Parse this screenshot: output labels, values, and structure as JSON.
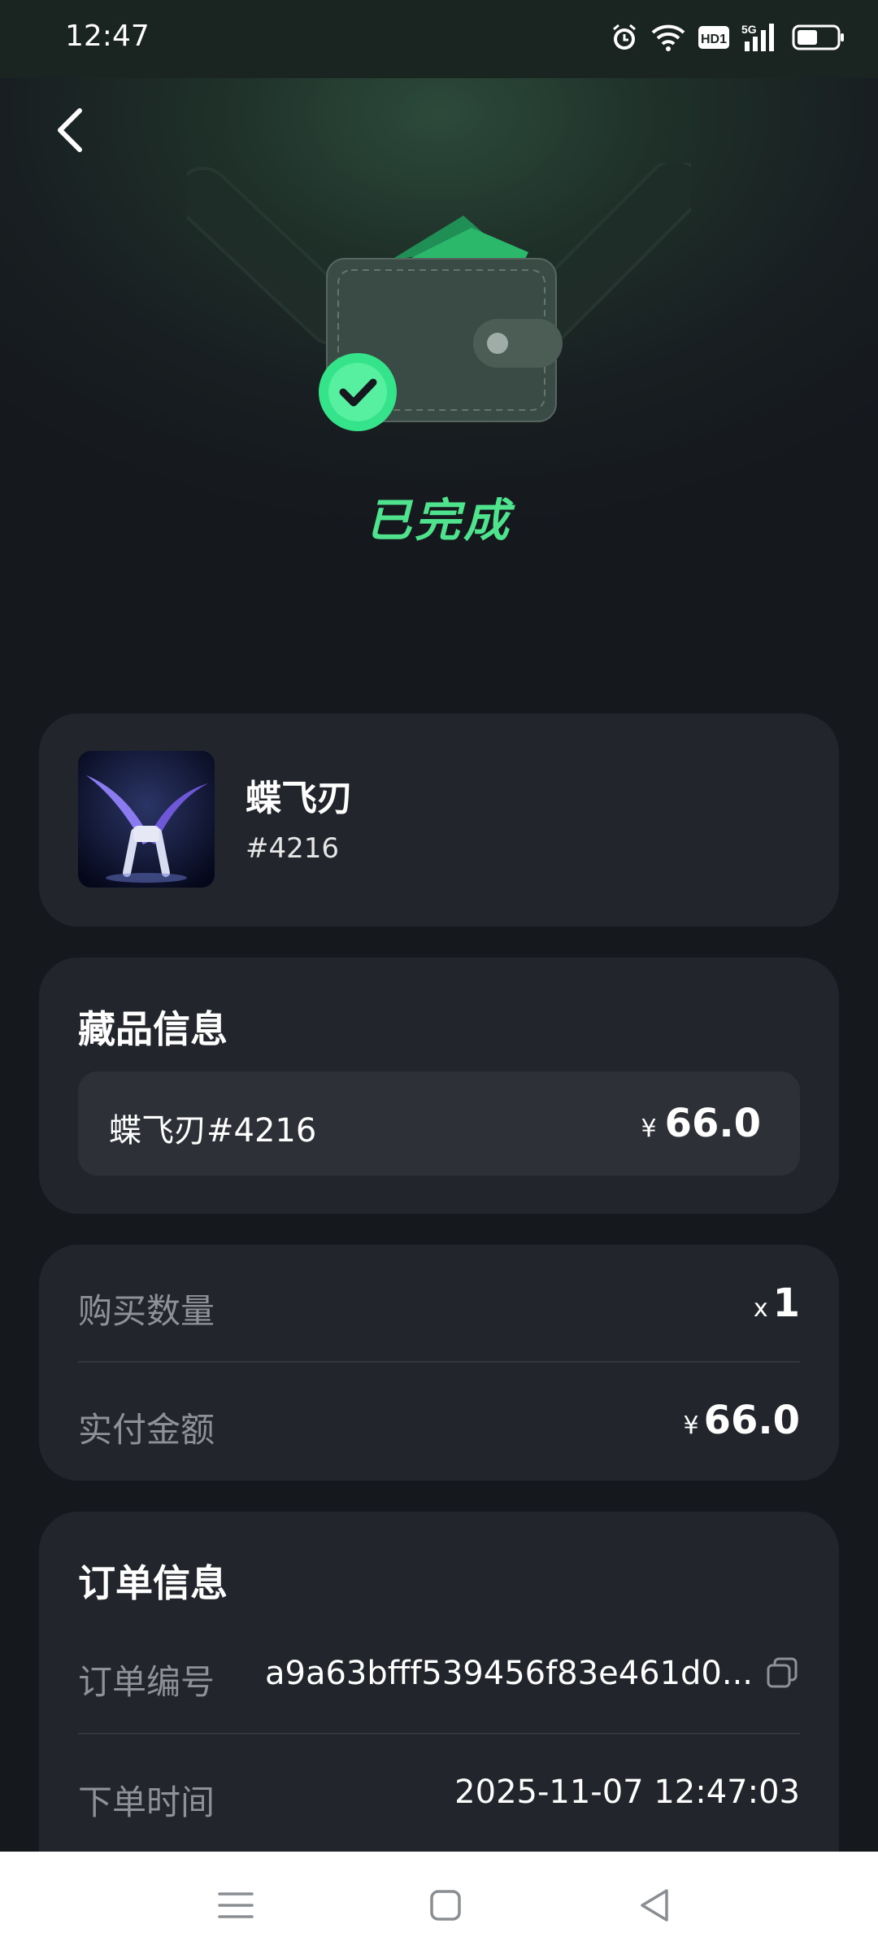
{
  "status_bar": {
    "time": "12:47",
    "icons": [
      "alarm-icon",
      "wifi-icon",
      "hd-icon",
      "signal-5g-icon",
      "battery-icon"
    ],
    "hd_label": "HD1",
    "network_label": "5G"
  },
  "header": {
    "back_icon": "chevron-left-icon"
  },
  "hero": {
    "status": "已完成",
    "accent": "#4fe38e"
  },
  "product": {
    "name": "蝶飞刃",
    "number": "#4216"
  },
  "collection": {
    "title": "藏品信息",
    "item_name": "蝶飞刃#4216",
    "currency": "¥",
    "price": "66.0"
  },
  "purchase": {
    "quantity_label": "购买数量",
    "quantity_prefix": "x",
    "quantity": "1",
    "paid_label": "实付金额",
    "currency": "¥",
    "paid_amount": "66.0"
  },
  "order": {
    "title": "订单信息",
    "number_label": "订单编号",
    "number_value": "a9a63bfff539456f83e461d0...",
    "time_label": "下单时间",
    "time_value": "2025-11-07 12:47:03"
  },
  "nav": {
    "icons": [
      "menu-icon",
      "home-icon",
      "back-icon"
    ]
  }
}
